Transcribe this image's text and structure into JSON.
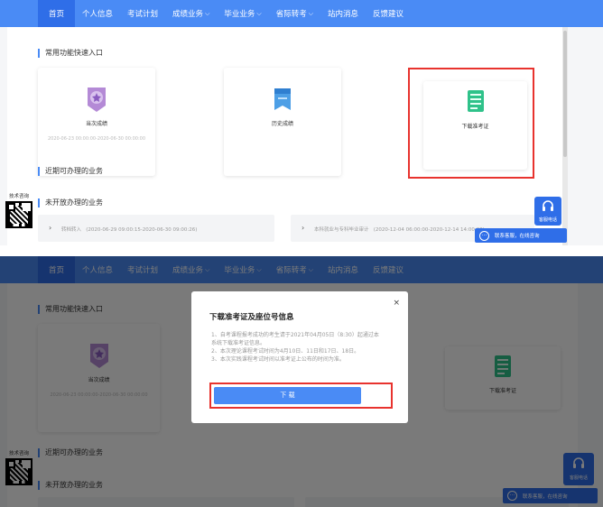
{
  "nav": {
    "items": [
      {
        "label": "首页",
        "caret": false
      },
      {
        "label": "个人信息",
        "caret": false
      },
      {
        "label": "考试计划",
        "caret": false
      },
      {
        "label": "成绩业务",
        "caret": true
      },
      {
        "label": "毕业业务",
        "caret": true
      },
      {
        "label": "省际转考",
        "caret": true
      },
      {
        "label": "站内消息",
        "caret": false
      },
      {
        "label": "反馈建议",
        "caret": false
      }
    ],
    "caret_glyph": "⌵"
  },
  "sections": {
    "quick_entry": "常用功能快速入口",
    "recent": "近期可办理的业务",
    "not_open": "未开放办理的业务"
  },
  "cards": {
    "current_score": {
      "label": "当次成绩",
      "date": "2020-06-23 00:00:00-2020-06-30 00:00:00"
    },
    "history_score": {
      "label": "历史成绩"
    },
    "admit_card": {
      "label": "下载准考证"
    }
  },
  "tasks": {
    "t1": {
      "label": "转档转入",
      "date": "(2020-06-29 09:00:15-2020-06-30 09:00:26)"
    },
    "t2": {
      "label": "本科就业与专科毕业审计",
      "date": "(2020-12-04 06:00:00-2020-12-14 14:00:00)"
    }
  },
  "qr": {
    "caption": "技术咨询"
  },
  "service": {
    "label": "客服电话"
  },
  "chat": {
    "label": "联系客服，在线咨询",
    "icon": "···"
  },
  "modal": {
    "title": "下载准考证及座位号信息",
    "notes": [
      "1、自考课程报考成功的考生请于2021年04月05日（8:30）起通过本系统下载准考证信息。",
      "2、本次理论课程考试时间为4月10日、11日和17日、18日。",
      "3、本次实践课程考试时间以准考证上公布的时间为准。"
    ],
    "download_label": "下 载",
    "close_label": "×"
  },
  "colors": {
    "accent": "#4a8bf5",
    "highlight": "#e8332e"
  }
}
